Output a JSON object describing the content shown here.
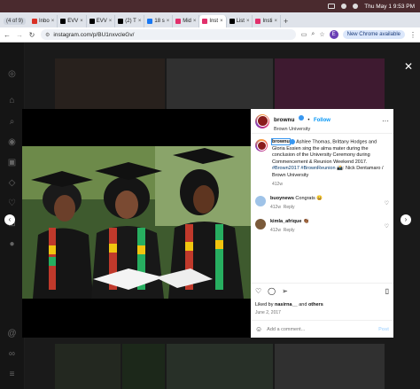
{
  "menubar": {
    "clock": "Thu May 1  9:53 PM"
  },
  "tabs": {
    "count_label": "(4 of 9)",
    "items": [
      {
        "label": "Inbo",
        "color": "#d93025"
      },
      {
        "label": "EVV",
        "color": "#000000"
      },
      {
        "label": "EVV",
        "color": "#000000"
      },
      {
        "label": "(2) T",
        "color": "#000000"
      },
      {
        "label": "18 s",
        "color": "#1877f2"
      },
      {
        "label": "Mid",
        "color": "#e1306c"
      },
      {
        "label": "Inst",
        "color": "#e1306c",
        "active": true
      },
      {
        "label": "List",
        "color": "#000000"
      },
      {
        "label": "Insti",
        "color": "#e1306c"
      }
    ]
  },
  "toolbar": {
    "url": "instagram.com/p/BU1nxvcleGv/",
    "profile_initial": "E",
    "update_label": "New Chrome available"
  },
  "post": {
    "author": "brownu",
    "follow_label": "Follow",
    "location": "Brown University",
    "caption_user": "brownu",
    "caption_text": " Ashlee Thomas, Brittany Hodges and Gloria Essien sing the alma mater during the conclusion of the University Ceremony during Commencement & Reunion Weekend 2017. ",
    "caption_tags": "#Brown2017 #BrownReunion",
    "caption_credit": " 📸: Nick Dentamaro / Brown University",
    "caption_age": "412w",
    "comments": [
      {
        "user": "buoynews",
        "text": " Congrats 😄",
        "age": "412w",
        "reply": "Reply"
      },
      {
        "user": "kimla_afrique",
        "text": " 👏🏾",
        "age": "412w",
        "reply": "Reply"
      }
    ],
    "liked_by_prefix": "Liked by ",
    "liked_by_user": "nasirna__",
    "liked_by_suffix": " and ",
    "liked_by_others": "others",
    "date": "June 2, 2017",
    "add_comment_placeholder": "Add a comment...",
    "post_label": "Post"
  },
  "colors": {
    "accent": "#0095f6",
    "verified": "#3897f0"
  }
}
